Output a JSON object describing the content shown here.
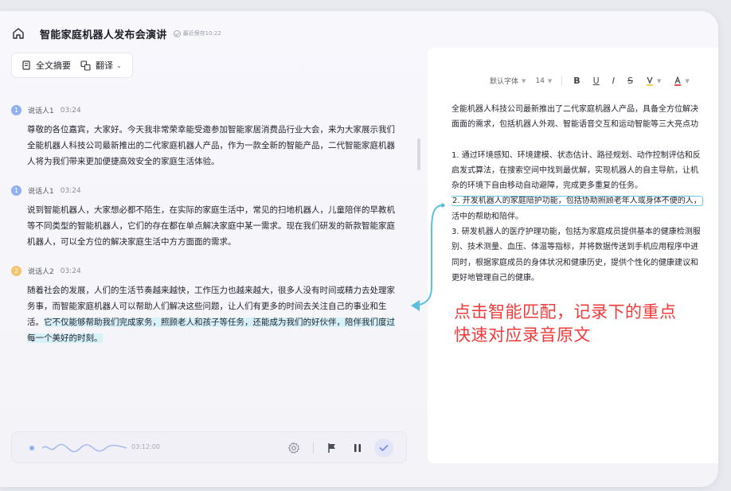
{
  "header": {
    "title": "智能家庭机器人发布会演讲",
    "save_status": "最近保存10:22"
  },
  "left_toolbar": {
    "summary_label": "全文摘要",
    "translate_label": "翻译"
  },
  "transcript": [
    {
      "badge": "1",
      "speaker": "说话人1",
      "time": "03:24",
      "lines": [
        "尊敬的各位嘉宾，大家好。今天我非常荣幸能受邀参加智能家居消费品行业大会，来为大家展示我们",
        "全能机器人科技公司最新推出的二代家庭机器人产品，作为一款全新的智能产品，二代智能家庭机器",
        "人将为我们带来更加便捷高效安全的家庭生活体验。"
      ]
    },
    {
      "badge": "1",
      "speaker": "说话人1",
      "time": "03:24",
      "lines": [
        "说到智能机器人，大家想必都不陌生，在实际的家庭生活中，常见的扫地机器人，儿童陪伴的早教机",
        "等不同类型的智能机器人，它们的存在都在单点解决家庭中某一需求。现在我们研发的新款智能家庭",
        "机器人，可以全方位的解决家庭生活中方方面面的需求。"
      ]
    },
    {
      "badge": "2",
      "speaker": "说话人2",
      "time": "03:24",
      "line1": "随着社会的发展，人们的生活节奏越来越快，工作压力也越来越大，很多人没有时间或精力去处理家",
      "line2": "务事，而智能家庭机器人可以帮助人们解决这些问题，让人们有更多的时间去关注自己的事业和生",
      "line3_plain": "活。",
      "line3_hl": "它不仅能够帮助我们完成家务，照顾老人和孩子等任务，还能成为我们的好伙伴，陪伴我们度过",
      "line4_hl": "每一个美好的时刻。"
    }
  ],
  "player": {
    "time": "03:12:00"
  },
  "doc_toolbar": {
    "font": "默认字体",
    "size": "14",
    "bold": "B",
    "underline": "U",
    "italic": "I",
    "strike": "S"
  },
  "doc": {
    "p1": "全能机器人科技公司最新推出了二代家庭机器人产品，具备全方位解决",
    "p2": "面面的需求，包括机器人外观、智能语音交互和运动智能等三大亮点功",
    "l1": "1. 通过环境感知、环境建模、状态估计、路径规划、动作控制评估和反",
    "l2": "启发式算法，在搜索空间中找到最优解，实现机器人的自主导航，让机",
    "l3": "杂的环境下自由移动自动避障，完成更多重复的任务。",
    "l4_box": "2. 开发机器人的家庭陪护功能，包括协助照顾老年人或身体不便的人，",
    "l5": "活中的帮助和陪伴。",
    "l6": "3. 研发机器人的医疗护理功能，包括为家庭成员提供基本的健康检测服",
    "l7": "别、技术测量、血压、体温等指标，并将数据传送到手机应用程序中进",
    "l8": "同时，根据家庭成员的身体状况和健康历史，提供个性化的健康建议和",
    "l9": "更好地管理自己的健康。"
  },
  "annotation": {
    "line1": "点击智能匹配，记录下的重点",
    "line2": "快速对应录音原文"
  },
  "colors": {
    "highlight": "#d6f1f7",
    "connector": "#5bc0de",
    "annotation": "#f23a3a",
    "accent": "#8fb0f3"
  }
}
